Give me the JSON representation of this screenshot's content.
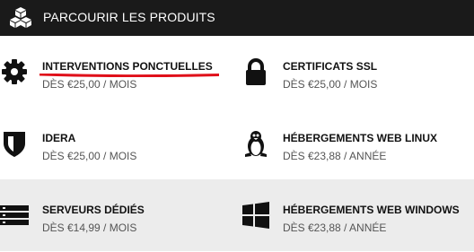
{
  "header": {
    "title": "PARCOURIR LES PRODUITS",
    "logo_icon": "boxes-icon"
  },
  "products": [
    {
      "name": "INTERVENTIONS PONCTUELLES",
      "price": "DÈS €25,00 / MOIS",
      "icon": "gear-icon",
      "annotated": true
    },
    {
      "name": "CERTIFICATS SSL",
      "price": "DÈS €25,00 / MOIS",
      "icon": "lock-icon"
    },
    {
      "name": "IDERA",
      "price": "DÈS €25,00 / MOIS",
      "icon": "shield-icon"
    },
    {
      "name": "HÉBERGEMENTS WEB LINUX",
      "price": "DÈS €23,88 / ANNÉE",
      "icon": "linux-penguin-icon"
    },
    {
      "name": "SERVEURS DÉDIÉS",
      "price": "DÈS €14,99 / MOIS",
      "icon": "server-rack-icon"
    },
    {
      "name": "HÉBERGEMENTS WEB WINDOWS",
      "price": "DÈS €23,88 / ANNÉE",
      "icon": "windows-icon"
    }
  ],
  "colors": {
    "header_bg": "#1a1a1a",
    "highlight_row_bg": "#ececec",
    "annotation_red": "#e0101a"
  }
}
